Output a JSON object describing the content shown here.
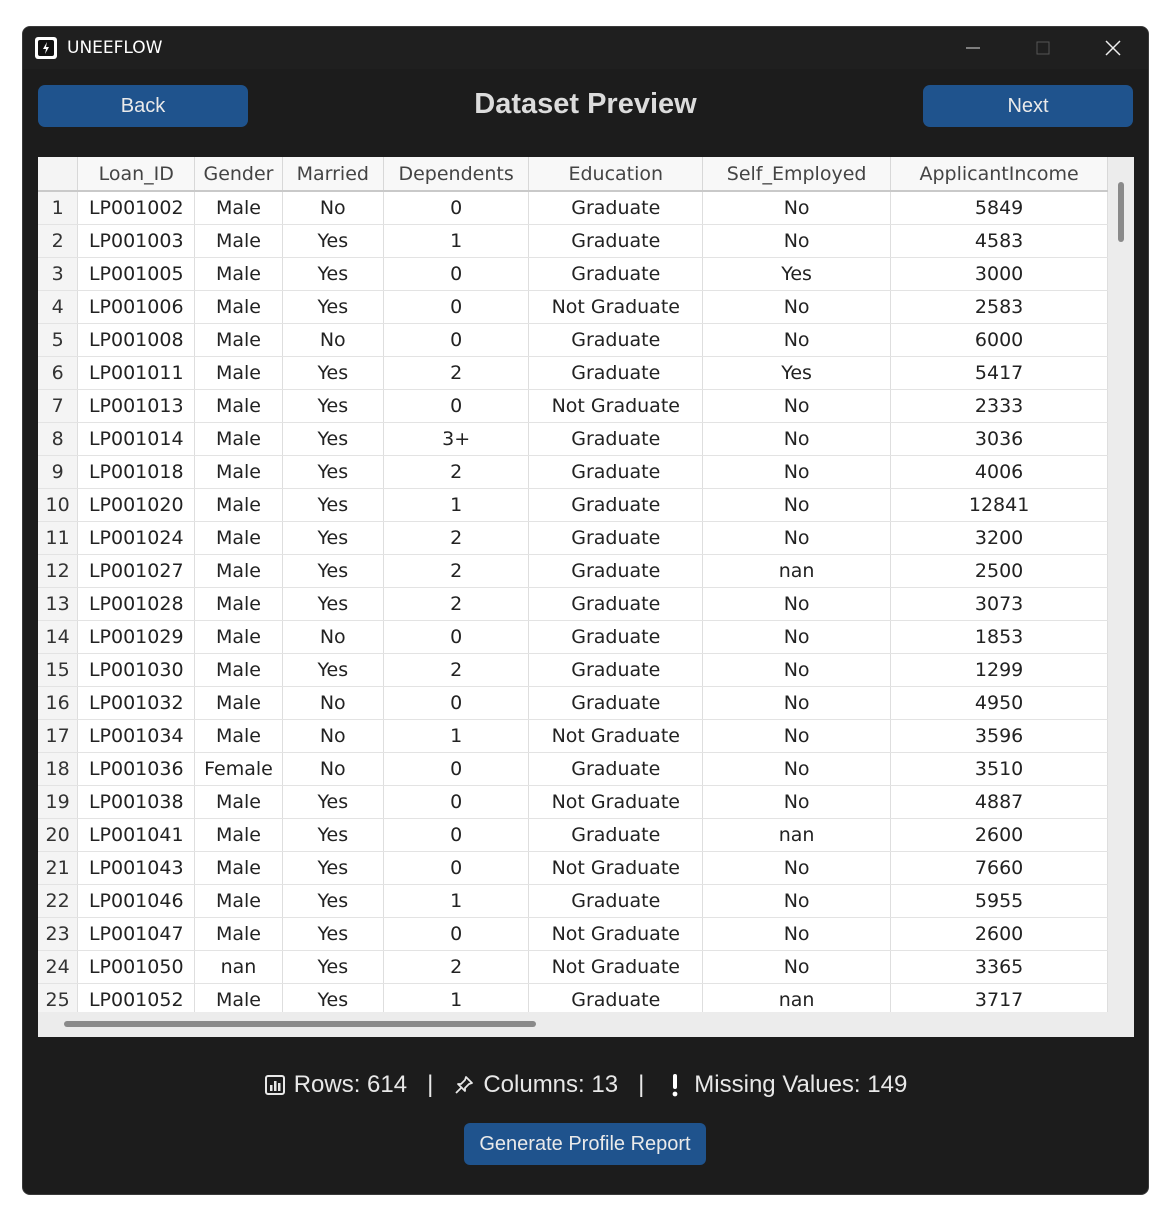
{
  "window": {
    "title": "UNEEFLOW"
  },
  "header": {
    "back_label": "Back",
    "title": "Dataset Preview",
    "next_label": "Next"
  },
  "table": {
    "columns": [
      "",
      "Loan_ID",
      "Gender",
      "Married",
      "Dependents",
      "Education",
      "Self_Employed",
      "ApplicantIncome"
    ],
    "rows": [
      [
        "1",
        "LP001002",
        "Male",
        "No",
        "0",
        "Graduate",
        "No",
        "5849"
      ],
      [
        "2",
        "LP001003",
        "Male",
        "Yes",
        "1",
        "Graduate",
        "No",
        "4583"
      ],
      [
        "3",
        "LP001005",
        "Male",
        "Yes",
        "0",
        "Graduate",
        "Yes",
        "3000"
      ],
      [
        "4",
        "LP001006",
        "Male",
        "Yes",
        "0",
        "Not Graduate",
        "No",
        "2583"
      ],
      [
        "5",
        "LP001008",
        "Male",
        "No",
        "0",
        "Graduate",
        "No",
        "6000"
      ],
      [
        "6",
        "LP001011",
        "Male",
        "Yes",
        "2",
        "Graduate",
        "Yes",
        "5417"
      ],
      [
        "7",
        "LP001013",
        "Male",
        "Yes",
        "0",
        "Not Graduate",
        "No",
        "2333"
      ],
      [
        "8",
        "LP001014",
        "Male",
        "Yes",
        "3+",
        "Graduate",
        "No",
        "3036"
      ],
      [
        "9",
        "LP001018",
        "Male",
        "Yes",
        "2",
        "Graduate",
        "No",
        "4006"
      ],
      [
        "10",
        "LP001020",
        "Male",
        "Yes",
        "1",
        "Graduate",
        "No",
        "12841"
      ],
      [
        "11",
        "LP001024",
        "Male",
        "Yes",
        "2",
        "Graduate",
        "No",
        "3200"
      ],
      [
        "12",
        "LP001027",
        "Male",
        "Yes",
        "2",
        "Graduate",
        "nan",
        "2500"
      ],
      [
        "13",
        "LP001028",
        "Male",
        "Yes",
        "2",
        "Graduate",
        "No",
        "3073"
      ],
      [
        "14",
        "LP001029",
        "Male",
        "No",
        "0",
        "Graduate",
        "No",
        "1853"
      ],
      [
        "15",
        "LP001030",
        "Male",
        "Yes",
        "2",
        "Graduate",
        "No",
        "1299"
      ],
      [
        "16",
        "LP001032",
        "Male",
        "No",
        "0",
        "Graduate",
        "No",
        "4950"
      ],
      [
        "17",
        "LP001034",
        "Male",
        "No",
        "1",
        "Not Graduate",
        "No",
        "3596"
      ],
      [
        "18",
        "LP001036",
        "Female",
        "No",
        "0",
        "Graduate",
        "No",
        "3510"
      ],
      [
        "19",
        "LP001038",
        "Male",
        "Yes",
        "0",
        "Not Graduate",
        "No",
        "4887"
      ],
      [
        "20",
        "LP001041",
        "Male",
        "Yes",
        "0",
        "Graduate",
        "nan",
        "2600"
      ],
      [
        "21",
        "LP001043",
        "Male",
        "Yes",
        "0",
        "Not Graduate",
        "No",
        "7660"
      ],
      [
        "22",
        "LP001046",
        "Male",
        "Yes",
        "1",
        "Graduate",
        "No",
        "5955"
      ],
      [
        "23",
        "LP001047",
        "Male",
        "Yes",
        "0",
        "Not Graduate",
        "No",
        "2600"
      ],
      [
        "24",
        "LP001050",
        "nan",
        "Yes",
        "2",
        "Not Graduate",
        "No",
        "3365"
      ],
      [
        "25",
        "LP001052",
        "Male",
        "Yes",
        "1",
        "Graduate",
        "nan",
        "3717"
      ]
    ]
  },
  "stats": {
    "rows_text": "Rows: 614",
    "columns_text": "Columns: 13",
    "missing_text": "Missing Values: 149",
    "separator": "|"
  },
  "footer": {
    "report_label": "Generate Profile Report"
  },
  "colors": {
    "accent": "#1f538d",
    "window_bg": "#1c1c1c"
  },
  "icons": {
    "rows": "bar-chart-icon",
    "columns": "pushpin-icon",
    "missing": "exclamation-icon"
  }
}
